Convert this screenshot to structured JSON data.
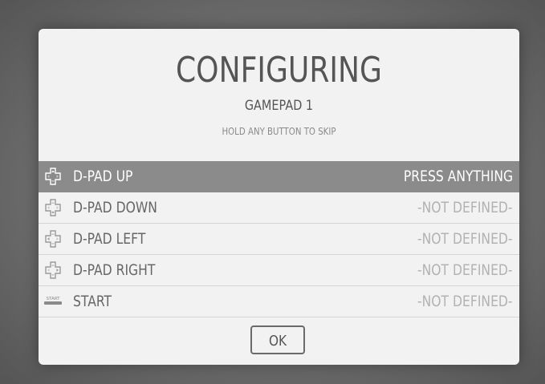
{
  "dialog": {
    "title": "CONFIGURING",
    "subtitle": "GAMEPAD 1",
    "hint": "HOLD ANY BUTTON TO SKIP",
    "ok_label": "OK"
  },
  "inputs": [
    {
      "label": "D-PAD UP",
      "status": "PRESS ANYTHING",
      "icon": "dpad-up-icon",
      "selected": true
    },
    {
      "label": "D-PAD DOWN",
      "status": "-NOT DEFINED-",
      "icon": "dpad-down-icon",
      "selected": false
    },
    {
      "label": "D-PAD LEFT",
      "status": "-NOT DEFINED-",
      "icon": "dpad-left-icon",
      "selected": false
    },
    {
      "label": "D-PAD RIGHT",
      "status": "-NOT DEFINED-",
      "icon": "dpad-right-icon",
      "selected": false
    },
    {
      "label": "START",
      "status": "-NOT DEFINED-",
      "icon": "start-button-icon",
      "icon_text": "START",
      "selected": false
    }
  ],
  "colors": {
    "selected_row": "#8b8b8b",
    "dialog_bg": "#f2f2f2",
    "text": "#555555",
    "muted": "#b2b2b2"
  }
}
